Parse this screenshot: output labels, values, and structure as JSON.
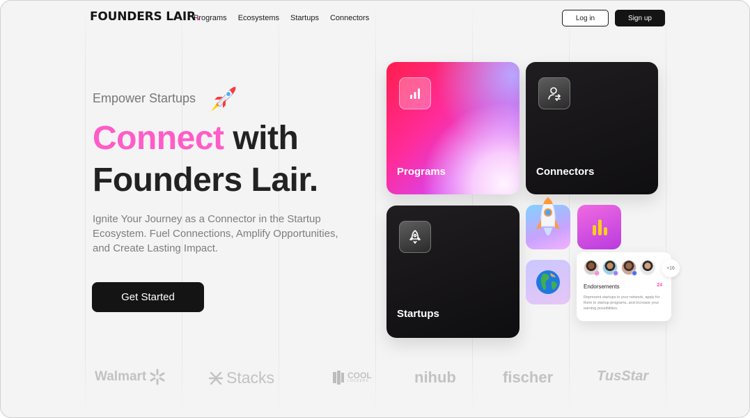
{
  "nav": {
    "logo_text": "FOUNDERS LAIR",
    "logo_dot": ".",
    "links": [
      "Programs",
      "Ecosystems",
      "Startups",
      "Connectors"
    ],
    "login_label": "Log in",
    "signup_label": "Sign up"
  },
  "hero": {
    "eyebrow": "Empower Startups",
    "headline_accent": "Connect",
    "headline_rest_1": " with",
    "headline_line_2": "Founders Lair.",
    "subtext": "Ignite Your Journey as a Connector in the Startup Ecosystem. Fuel Connections, Amplify Opportunities, and Create Lasting Impact.",
    "cta_label": "Get Started"
  },
  "cards": {
    "programs": "Programs",
    "connectors": "Connectors",
    "startups": "Startups"
  },
  "endorsements": {
    "more_count": "+16",
    "title": "Endorsements",
    "count": "24",
    "description": "Represent startups in your network, apply for them to startup programs, and increase your earning possibilities."
  },
  "brands": {
    "walmart": "Walmart",
    "stacks": "Stacks",
    "cool_top": "COOL",
    "cool_bottom": "LOCKERS",
    "nihub": "nihub",
    "fischer": "fischer",
    "tusstar": "TusStar"
  },
  "colors": {
    "accent_pink": "#ff5cc8",
    "dark": "#141414",
    "muted_text": "#7d7d7d"
  }
}
